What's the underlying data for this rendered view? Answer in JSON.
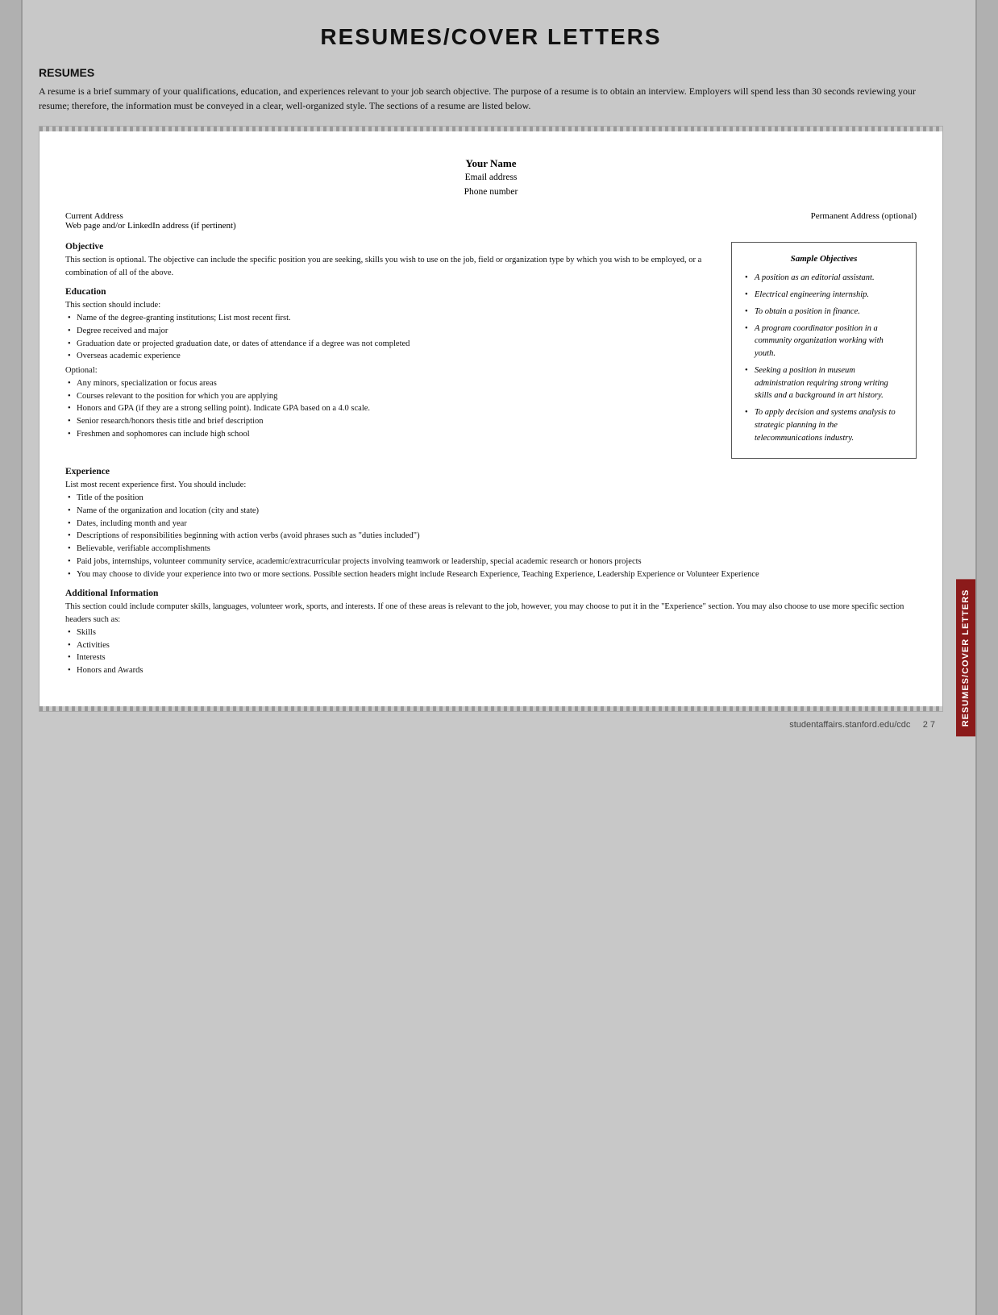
{
  "page": {
    "title": "RESUMES/COVER LETTERS",
    "vertical_tab": "RESUMES/COVER LETTERS",
    "footer": {
      "url": "studentaffairs.stanford.edu/cdc",
      "page_number": "2 7"
    }
  },
  "intro": {
    "heading": "RESUMES",
    "body": "A resume is a brief summary of your qualifications, education, and experiences relevant to your job search objective. The purpose of a resume is to obtain an interview. Employers will spend less than 30 seconds reviewing your resume; therefore, the information must be conveyed in a clear, well-organized style. The sections of a resume are listed below."
  },
  "resume_template": {
    "header": {
      "name": "Your Name",
      "email": "Email address",
      "phone": "Phone number"
    },
    "address": {
      "current": "Current Address",
      "web": "Web page and/or LinkedIn address (if pertinent)",
      "permanent": "Permanent Address (optional)"
    },
    "objective": {
      "title": "Objective",
      "body": "This section is optional. The objective can include the specific position you are seeking, skills you wish to use on the job, field or organization type by which you wish to be employed, or a combination of all of the above."
    },
    "sample_objectives": {
      "title": "Sample Objectives",
      "items": [
        "A position as an editorial assistant.",
        "Electrical engineering internship.",
        "To obtain a position in finance.",
        "A program coordinator position in a community organization working with youth.",
        "Seeking a position in museum administration requiring strong writing skills and a background in art history.",
        "To apply decision and systems analysis to strategic planning in the telecommunications industry."
      ]
    },
    "education": {
      "title": "Education",
      "intro": "This section should include:",
      "required_items": [
        "Name of the degree-granting institutions; List most recent first.",
        "Degree received and major",
        "Graduation date or projected graduation date, or dates of attendance if a degree was not completed",
        "Overseas academic experience"
      ],
      "optional_label": "Optional:",
      "optional_items": [
        "Any minors, specialization or focus areas",
        "Courses relevant to the position for which you are applying",
        "Honors and GPA (if they are a strong selling point). Indicate GPA based on a 4.0 scale.",
        "Senior research/honors thesis title and brief description",
        "Freshmen and sophomores can include high school"
      ]
    },
    "experience": {
      "title": "Experience",
      "intro": "List most recent experience first. You should include:",
      "items": [
        "Title of the position",
        "Name of the organization and location (city and state)",
        "Dates, including month and year",
        "Descriptions of responsibilities beginning with action verbs (avoid phrases such as \"duties included\")",
        "Believable, verifiable accomplishments",
        "Paid jobs, internships, volunteer community service, academic/extracurricular projects involving teamwork or leadership, special academic research or honors projects",
        "You may choose to divide your experience into two or more sections. Possible section headers might include Research Experience, Teaching Experience, Leadership Experience or Volunteer Experience"
      ]
    },
    "additional_information": {
      "title": "Additional Information",
      "body": "This section could include computer skills, languages, volunteer work, sports, and interests. If one of these areas is relevant to the job, however, you may choose to put it in the \"Experience\" section. You may also choose to use more specific section headers such as:",
      "items": [
        "Skills",
        "Activities",
        "Interests",
        "Honors and Awards"
      ]
    }
  }
}
